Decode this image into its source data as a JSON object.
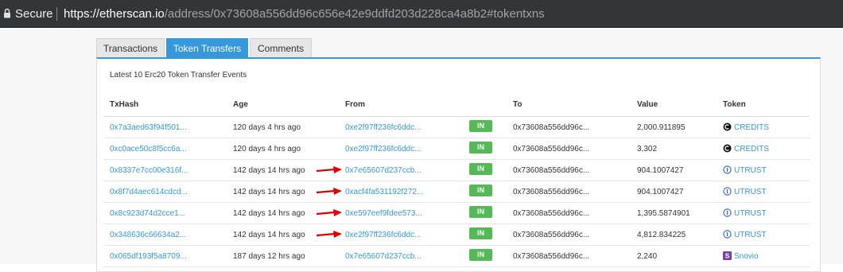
{
  "addressbar": {
    "secure_label": "Secure",
    "url_host": "https://etherscan.io",
    "url_path": "/address/0x73608a556dd96c656e42e9ddfd203d228ca4a8b2#tokentxns"
  },
  "tabs": [
    {
      "label": "Transactions",
      "active": false
    },
    {
      "label": "Token Transfers",
      "active": true
    },
    {
      "label": "Comments",
      "active": false
    }
  ],
  "panel": {
    "title": "Latest 10 Erc20 Token Transfer Events",
    "columns": [
      "TxHash",
      "Age",
      "From",
      "To",
      "Value",
      "Token"
    ],
    "rows": [
      {
        "hash": "0x7a3aed63f94f501...",
        "age": "120 days 4 hrs ago",
        "from": "0xe2f97ff236fc6ddc...",
        "dir": "IN",
        "to": "0x73608a556dd96c...",
        "value": "2,000.911895",
        "token": "CREDITS",
        "token_icon": "credits-icon",
        "arrow": false
      },
      {
        "hash": "0xc0ace50c8f5cc6a...",
        "age": "120 days 4 hrs ago",
        "from": "0xe2f97ff236fc6ddc...",
        "dir": "IN",
        "to": "0x73608a556dd96c...",
        "value": "3,302",
        "token": "CREDITS",
        "token_icon": "credits-icon",
        "arrow": false
      },
      {
        "hash": "0x8337e7cc00e316f...",
        "age": "142 days 14 hrs ago",
        "from": "0x7e65607d237ccb...",
        "dir": "IN",
        "to": "0x73608a556dd96c...",
        "value": "904.1007427",
        "token": "UTRUST",
        "token_icon": "utrust-icon",
        "arrow": true
      },
      {
        "hash": "0x8f7d4aec614cdcd...",
        "age": "142 days 14 hrs ago",
        "from": "0xacf4fa531192f272...",
        "dir": "IN",
        "to": "0x73608a556dd96c...",
        "value": "904.1007427",
        "token": "UTRUST",
        "token_icon": "utrust-icon",
        "arrow": true
      },
      {
        "hash": "0x8c923d74d2cce1...",
        "age": "142 days 14 hrs ago",
        "from": "0xe597eef9fdee573...",
        "dir": "IN",
        "to": "0x73608a556dd96c...",
        "value": "1,395.5874901",
        "token": "UTRUST",
        "token_icon": "utrust-icon",
        "arrow": true
      },
      {
        "hash": "0x348636c66634a2...",
        "age": "142 days 14 hrs ago",
        "from": "0xe2f97ff236fc6ddc...",
        "dir": "IN",
        "to": "0x73608a556dd96c...",
        "value": "4,812.834225",
        "token": "UTRUST",
        "token_icon": "utrust-icon",
        "arrow": true
      },
      {
        "hash": "0x065df193f5a8709...",
        "age": "187 days 12 hrs ago",
        "from": "0x7e65607d237ccb...",
        "dir": "IN",
        "to": "0x73608a556dd96c...",
        "value": "2,240",
        "token": "Snovio",
        "token_icon": "snovio-icon",
        "arrow": false
      }
    ]
  },
  "colors": {
    "link": "#3498db",
    "in_badge": "#56b957",
    "annotation_arrow": "#e00000"
  }
}
